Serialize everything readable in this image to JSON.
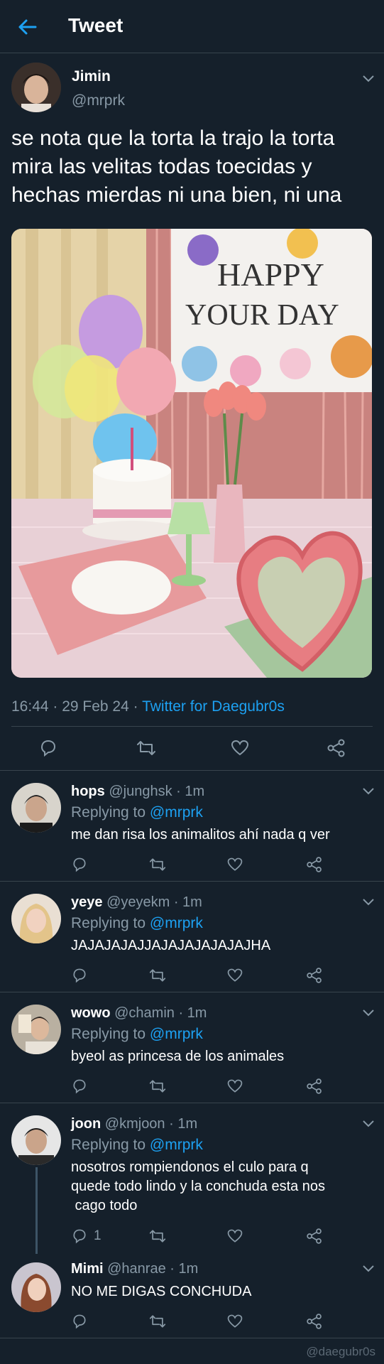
{
  "header": {
    "title": "Tweet"
  },
  "tweet": {
    "name": "Jimin",
    "handle": "@mrprk",
    "text_lines": [
      "se nota que la torta la trajo la torta",
      "mira las velitas todas toecidas y",
      "hechas mierdas ni una bien, ni una"
    ],
    "time": "16:44 · 29 Feb 24 · ",
    "source": "Twitter for Daegubr0s",
    "photo": {
      "banner_line1": "HAPPY",
      "banner_line2": "YOUR DAY"
    }
  },
  "replies": [
    {
      "name": "hops",
      "handle": "@junghsk · 1m",
      "replying_label": "Replying to ",
      "replying_to": "@mrprk",
      "text_lines": [
        "me dan risa los animalitos ahí nada q ver"
      ],
      "reply_count": ""
    },
    {
      "name": "yeye",
      "handle": "@yeyekm · 1m",
      "replying_label": "Replying to ",
      "replying_to": "@mrprk",
      "text_lines": [
        "JAJAJAJAJJAJAJAJAJAJAJHA"
      ],
      "reply_count": ""
    },
    {
      "name": "wowo",
      "handle": "@chamin · 1m",
      "replying_label": "Replying to ",
      "replying_to": "@mrprk",
      "text_lines": [
        "byeol as princesa de los animales"
      ],
      "reply_count": ""
    },
    {
      "name": "joon",
      "handle": "@kmjoon · 1m",
      "replying_label": "Replying to ",
      "replying_to": "@mrprk",
      "text_lines": [
        "nosotros rompiendonos el culo para q",
        "quede todo lindo y la conchuda esta nos",
        " cago todo"
      ],
      "reply_count": "1"
    },
    {
      "name": "Mimi",
      "handle": "@hanrae · 1m",
      "replying_label": "",
      "replying_to": "",
      "text_lines": [
        "NO ME DIGAS CONCHUDA"
      ],
      "reply_count": ""
    }
  ],
  "watermark": "@daegubr0s",
  "colors": {
    "background": "#15202b",
    "accent": "#1da1f2",
    "muted": "#8899a6",
    "divider": "#38444d"
  }
}
